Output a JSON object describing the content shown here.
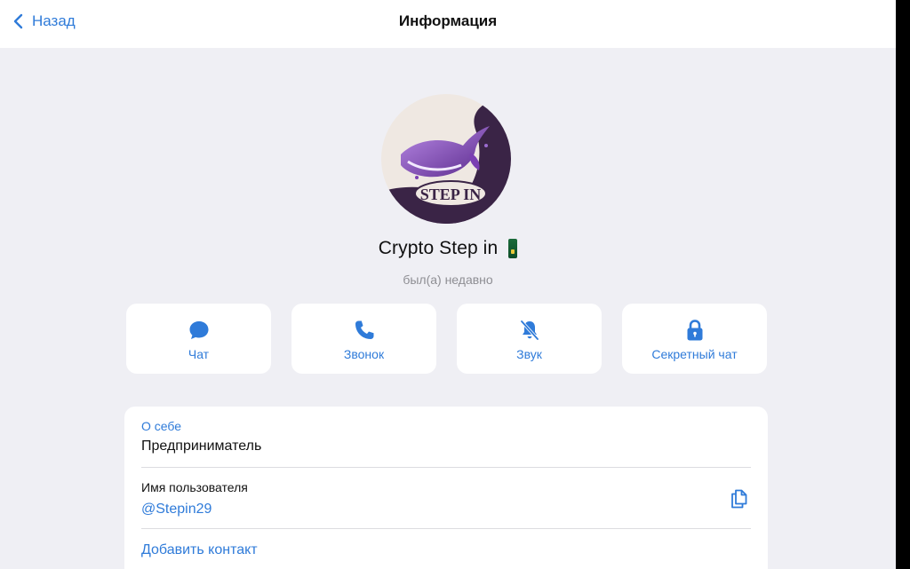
{
  "navbar": {
    "back_label": "Назад",
    "title": "Информация"
  },
  "avatar": {
    "logo_text": "STEP IN"
  },
  "profile": {
    "name": "Crypto Step in",
    "status": "был(а) недавно"
  },
  "actions": [
    {
      "label": "Чат",
      "icon": "chat-bubble-icon"
    },
    {
      "label": "Звонок",
      "icon": "phone-icon"
    },
    {
      "label": "Звук",
      "icon": "bell-slash-icon"
    },
    {
      "label": "Секретный чат",
      "icon": "lock-icon"
    }
  ],
  "info": {
    "about_label": "О себе",
    "about_value": "Предприниматель",
    "username_label": "Имя пользователя",
    "username_value": "@Stepin29",
    "add_contact": "Добавить контакт"
  },
  "colors": {
    "accent": "#2f7bd9",
    "background": "#efeff4",
    "card": "#ffffff"
  }
}
